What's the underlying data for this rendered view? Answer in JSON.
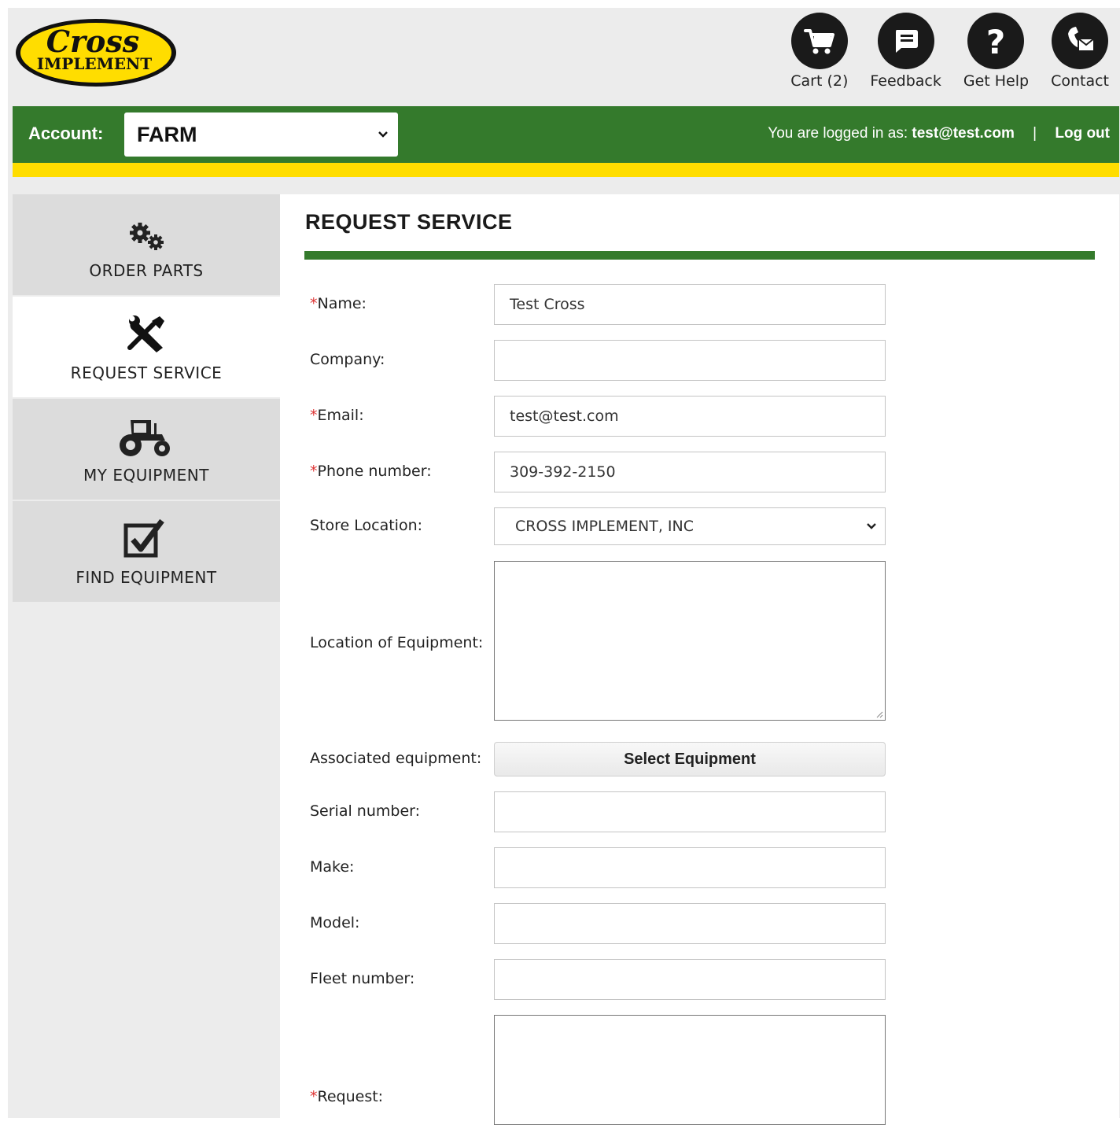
{
  "brand": {
    "logo_line1": "Cross",
    "logo_line2": "IMPLEMENT",
    "yellow": "#ffdd00",
    "green": "#347a2c",
    "dark": "#1a1a1a"
  },
  "topnav": [
    {
      "label": "Cart (2)",
      "icon": "cart-icon"
    },
    {
      "label": "Feedback",
      "icon": "feedback-icon"
    },
    {
      "label": "Get Help",
      "icon": "help-icon"
    },
    {
      "label": "Contact",
      "icon": "contact-icon"
    }
  ],
  "account": {
    "label": "Account:",
    "selected": "FARM"
  },
  "login": {
    "prefix": "You are logged in as:",
    "user": "test@test.com",
    "separator": "|",
    "logout": "Log out"
  },
  "sidebar": {
    "items": [
      {
        "label": "ORDER PARTS",
        "icon": "gears-icon",
        "active": false
      },
      {
        "label": "REQUEST SERVICE",
        "icon": "wrench-screwdriver-icon",
        "active": true
      },
      {
        "label": "MY EQUIPMENT",
        "icon": "tractor-icon",
        "active": false
      },
      {
        "label": "FIND EQUIPMENT",
        "icon": "checkbox-icon",
        "active": false
      }
    ]
  },
  "page": {
    "title": "REQUEST SERVICE"
  },
  "form": {
    "required_mark": "*",
    "name": {
      "label": "Name:",
      "value": "Test Cross"
    },
    "company": {
      "label": "Company:",
      "value": ""
    },
    "email": {
      "label": "Email:",
      "value": "test@test.com"
    },
    "phone": {
      "label": "Phone number:",
      "value": "309-392-2150"
    },
    "store": {
      "label": "Store Location:",
      "value": "CROSS IMPLEMENT, INC"
    },
    "location": {
      "label": "Location of Equipment:",
      "value": ""
    },
    "associated": {
      "label": "Associated equipment:",
      "button": "Select Equipment"
    },
    "serial": {
      "label": "Serial number:",
      "value": ""
    },
    "make": {
      "label": "Make:",
      "value": ""
    },
    "model": {
      "label": "Model:",
      "value": ""
    },
    "fleet": {
      "label": "Fleet number:",
      "value": ""
    },
    "request": {
      "label": "Request:",
      "value": ""
    }
  }
}
